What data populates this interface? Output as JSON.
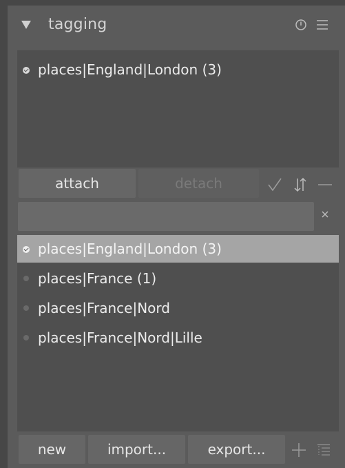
{
  "header": {
    "title": "tagging",
    "icons": [
      "collapse-arrow-icon",
      "power-icon",
      "presets-menu-icon"
    ]
  },
  "attached": {
    "items": [
      {
        "label": "places|England|London (3)",
        "checked": true
      }
    ]
  },
  "actions": {
    "attach_label": "attach",
    "detach_label": "detach",
    "icons": [
      "toggle-check-icon",
      "sort-icon",
      "collapse-minus-icon"
    ]
  },
  "search": {
    "value": "",
    "clear_icon": "clear-x-icon"
  },
  "dictionary": {
    "items": [
      {
        "label": "places|England|London (3)",
        "checked": true,
        "selected": true
      },
      {
        "label": "places|France (1)",
        "checked": false,
        "selected": false
      },
      {
        "label": "places|France|Nord",
        "checked": false,
        "selected": false
      },
      {
        "label": "places|France|Nord|Lille",
        "checked": false,
        "selected": false
      }
    ]
  },
  "footer": {
    "new_label": "new",
    "import_label": "import...",
    "export_label": "export...",
    "icons": [
      "add-icon",
      "toggle-tree-icon"
    ]
  },
  "colors": {
    "background": "#474747",
    "panel": "#5b5b5b",
    "list_bg": "#4f4f4f",
    "selected_row": "#a5a5a5",
    "button": "#666666"
  }
}
